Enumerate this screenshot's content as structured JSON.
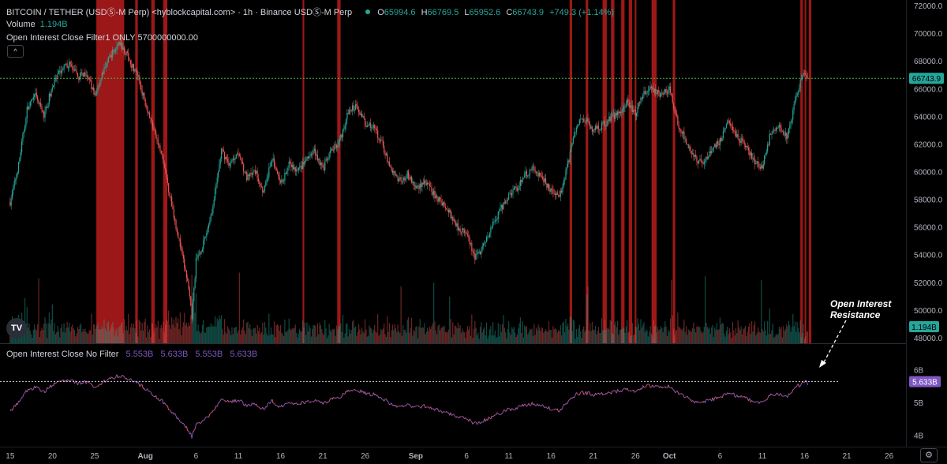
{
  "header": {
    "symbol": "BITCOIN / TETHER (USDⓈ-M Perp) <hyblockcapital.com> · 1h · Binance USDⓈ-M Perp",
    "open_label": "O",
    "open": "65994.6",
    "high_label": "H",
    "high": "66769.5",
    "low_label": "L",
    "low": "65952.6",
    "close_label": "C",
    "close": "66743.9",
    "change": "+749.3 (+1.14%)"
  },
  "volume": {
    "label": "Volume",
    "value": "1.194B"
  },
  "filter_label": "Open Interest Close Filter1 ONLY 5700000000.00",
  "collapse_icon": "^",
  "oi_pane": {
    "label": "Open Interest Close No Filter",
    "values": [
      "5.553B",
      "5.633B",
      "5.553B",
      "5.633B"
    ]
  },
  "logo_text": "TV",
  "annotation": {
    "line1": "Open Interest",
    "line2": "Resistance"
  },
  "gear_icon": "⚙",
  "colors": {
    "up": "#26a69a",
    "down": "#ef5350",
    "highlight": "#b71c1c",
    "oi_line": "#7e57c2",
    "price_line": "#4caf50"
  },
  "chart_data": {
    "type": "candlestick",
    "price_axis": {
      "ticks": [
        "72000.0",
        "70000.0",
        "68000.0",
        "66000.0",
        "64000.0",
        "62000.0",
        "60000.0",
        "58000.0",
        "56000.0",
        "54000.0",
        "52000.0",
        "50000.0",
        "48000.0"
      ],
      "ylim": [
        47600,
        72400
      ]
    },
    "last_price_label": "66743.9",
    "volume_label": "1.194B",
    "oi_axis": {
      "ticks": [
        "6B",
        "5B",
        "4B"
      ],
      "ylim": [
        3.65,
        6.3
      ]
    },
    "oi_last_label": "5.633B",
    "oi_level": 5.64,
    "x_ticks": [
      "15",
      "20",
      "25",
      "Aug",
      "6",
      "11",
      "16",
      "21",
      "26",
      "Sep",
      "6",
      "11",
      "16",
      "21",
      "26",
      "Oct",
      "6",
      "11",
      "16",
      "21",
      "26"
    ],
    "x_tick_days": [
      0,
      5,
      10,
      16,
      22,
      27,
      32,
      37,
      42,
      48,
      54,
      59,
      64,
      69,
      74,
      78,
      84,
      89,
      94,
      99,
      104
    ],
    "day_range": [
      -1.2,
      106
    ],
    "price_anchors": [
      [
        0,
        57800
      ],
      [
        1,
        60500
      ],
      [
        2,
        64500
      ],
      [
        3,
        65500
      ],
      [
        4,
        64000
      ],
      [
        5,
        66200
      ],
      [
        6,
        67300
      ],
      [
        7,
        67800
      ],
      [
        8,
        66800
      ],
      [
        9,
        67200
      ],
      [
        10,
        65500
      ],
      [
        11,
        67200
      ],
      [
        12,
        68500
      ],
      [
        13,
        69300
      ],
      [
        14,
        68200
      ],
      [
        15,
        67000
      ],
      [
        16,
        65000
      ],
      [
        17,
        63000
      ],
      [
        18,
        61000
      ],
      [
        19,
        58000
      ],
      [
        20,
        55000
      ],
      [
        21,
        52000
      ],
      [
        21.5,
        49500
      ],
      [
        22,
        53500
      ],
      [
        23,
        55000
      ],
      [
        24,
        57500
      ],
      [
        25,
        61500
      ],
      [
        26,
        60500
      ],
      [
        27,
        61500
      ],
      [
        28,
        59500
      ],
      [
        29,
        60000
      ],
      [
        30,
        58500
      ],
      [
        31,
        61000
      ],
      [
        32,
        59000
      ],
      [
        33,
        60500
      ],
      [
        34,
        60000
      ],
      [
        35,
        60800
      ],
      [
        36,
        61500
      ],
      [
        37,
        60200
      ],
      [
        38,
        61500
      ],
      [
        39,
        62200
      ],
      [
        40,
        64300
      ],
      [
        41,
        64800
      ],
      [
        42,
        63500
      ],
      [
        43,
        63200
      ],
      [
        44,
        62000
      ],
      [
        45,
        60200
      ],
      [
        46,
        59300
      ],
      [
        47,
        59800
      ],
      [
        48,
        58800
      ],
      [
        49,
        59300
      ],
      [
        50,
        58500
      ],
      [
        51,
        57800
      ],
      [
        52,
        57000
      ],
      [
        53,
        56000
      ],
      [
        54,
        55500
      ],
      [
        55,
        53700
      ],
      [
        56,
        54600
      ],
      [
        57,
        56000
      ],
      [
        58,
        57200
      ],
      [
        59,
        58300
      ],
      [
        60,
        58800
      ],
      [
        61,
        59800
      ],
      [
        62,
        60200
      ],
      [
        63,
        59500
      ],
      [
        64,
        58600
      ],
      [
        65,
        58100
      ],
      [
        66,
        60600
      ],
      [
        67,
        63400
      ],
      [
        68,
        63800
      ],
      [
        69,
        63000
      ],
      [
        70,
        63300
      ],
      [
        71,
        63800
      ],
      [
        72,
        64300
      ],
      [
        73,
        65000
      ],
      [
        74,
        64200
      ],
      [
        75,
        65800
      ],
      [
        76,
        66000
      ],
      [
        77,
        65600
      ],
      [
        78,
        65900
      ],
      [
        79,
        63500
      ],
      [
        80,
        62200
      ],
      [
        81,
        61000
      ],
      [
        82,
        60500
      ],
      [
        83,
        61600
      ],
      [
        84,
        62200
      ],
      [
        85,
        63900
      ],
      [
        86,
        62500
      ],
      [
        87,
        62000
      ],
      [
        88,
        60800
      ],
      [
        89,
        60300
      ],
      [
        90,
        62800
      ],
      [
        91,
        63200
      ],
      [
        92,
        62500
      ],
      [
        93,
        65500
      ],
      [
        94,
        67300
      ],
      [
        94.4,
        66743.9
      ]
    ],
    "highlight_bands": [
      [
        10.2,
        13.5
      ],
      [
        14.8,
        15.1
      ],
      [
        16.7,
        17.1
      ],
      [
        18.1,
        18.6
      ],
      [
        34.6,
        34.8
      ],
      [
        38.7,
        39.1
      ],
      [
        66.2,
        66.5
      ],
      [
        68.1,
        68.4
      ],
      [
        70.1,
        70.6
      ],
      [
        71.1,
        71.5
      ],
      [
        72.3,
        72.7
      ],
      [
        73.2,
        73.6
      ],
      [
        73.9,
        74.1
      ],
      [
        75.9,
        76.5
      ],
      [
        78.4,
        78.7
      ],
      [
        93.5,
        93.8
      ],
      [
        94.0,
        94.2
      ],
      [
        94.5,
        94.8
      ]
    ]
  }
}
